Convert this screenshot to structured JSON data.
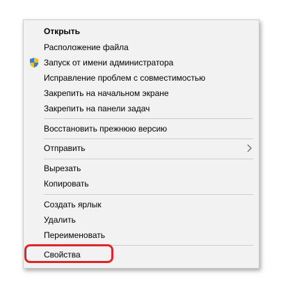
{
  "context_menu": {
    "items": [
      {
        "key": "open",
        "label": "Открыть"
      },
      {
        "key": "file-location",
        "label": "Расположение файла"
      },
      {
        "key": "run-as-admin",
        "label": "Запуск от имени администратора",
        "icon": "uac-shield-icon"
      },
      {
        "key": "troubleshoot-compat",
        "label": "Исправление проблем с совместимостью"
      },
      {
        "key": "pin-start",
        "label": "Закрепить на начальном экране"
      },
      {
        "key": "pin-taskbar",
        "label": "Закрепить на панели задач"
      },
      {
        "key": "restore-prev",
        "label": "Восстановить прежнюю версию"
      },
      {
        "key": "send-to",
        "label": "Отправить",
        "submenu_icon": "chevron-right-icon"
      },
      {
        "key": "cut",
        "label": "Вырезать"
      },
      {
        "key": "copy",
        "label": "Копировать"
      },
      {
        "key": "create-shortcut",
        "label": "Создать ярлык"
      },
      {
        "key": "delete",
        "label": "Удалить"
      },
      {
        "key": "rename",
        "label": "Переименовать"
      },
      {
        "key": "properties",
        "label": "Свойства",
        "highlighted": true
      }
    ]
  },
  "colors": {
    "menu_background": "#f2f2f2",
    "separator": "#cdcdcd",
    "highlight_outline": "#e0232a"
  }
}
